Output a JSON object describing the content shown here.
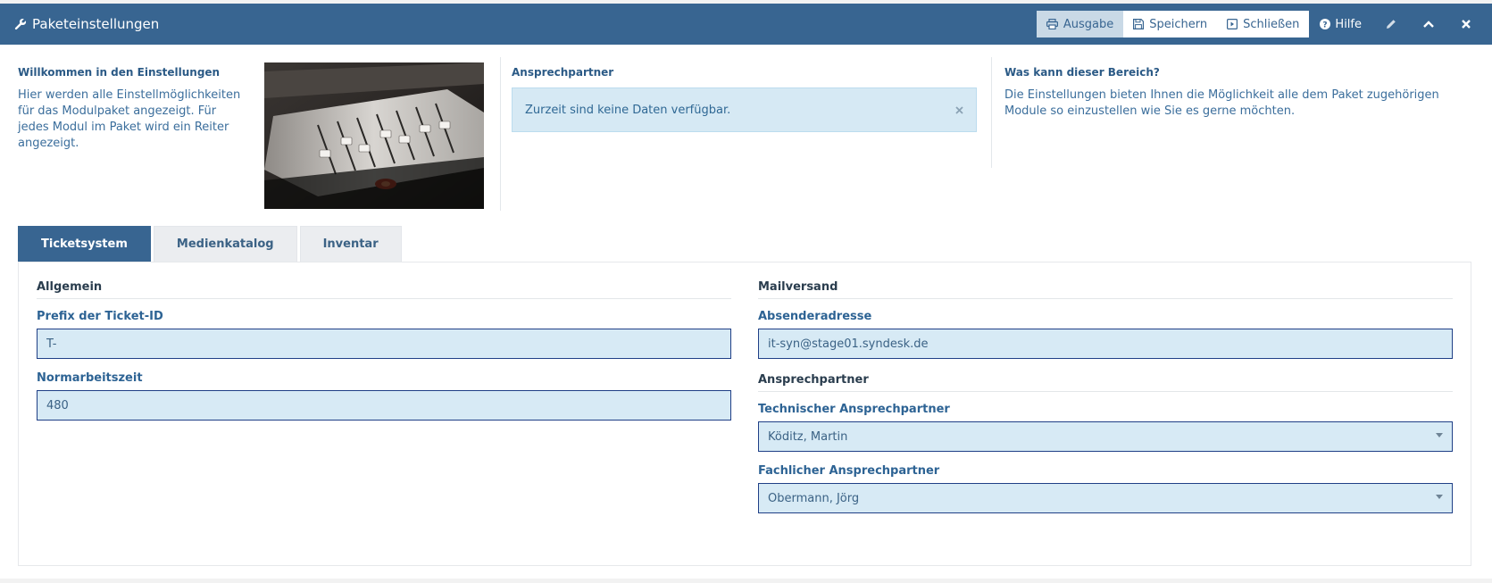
{
  "window": {
    "title": "Paketeinstellungen",
    "toolbar": {
      "output_label": "Ausgabe",
      "save_label": "Speichern",
      "close_label": "Schließen",
      "help_label": "Hilfe"
    }
  },
  "info": {
    "welcome": {
      "heading": "Willkommen in den Einstellungen",
      "text": "Hier werden alle Einstellmöglichkeiten für das Modulpaket angezeigt. Für jedes Modul im Paket wird ein Reiter angezeigt."
    },
    "contact": {
      "heading": "Ansprechpartner",
      "alert": "Zurzeit sind keine Daten verfügbar."
    },
    "about": {
      "heading": "Was kann dieser Bereich?",
      "text": "Die Einstellungen bieten Ihnen die Möglichkeit alle dem Paket zugehörigen Module so einzustellen wie Sie es gerne möchten."
    }
  },
  "tabs": [
    {
      "label": "Ticketsystem",
      "active": true
    },
    {
      "label": "Medienkatalog",
      "active": false
    },
    {
      "label": "Inventar",
      "active": false
    }
  ],
  "form": {
    "general": {
      "heading": "Allgemein",
      "prefix_label": "Prefix der Ticket-ID",
      "prefix_value": "T-",
      "worktime_label": "Normarbeitszeit",
      "worktime_value": "480"
    },
    "mail": {
      "heading": "Mailversand",
      "sender_label": "Absenderadresse",
      "sender_value": "it-syn@stage01.syndesk.de"
    },
    "contacts": {
      "heading": "Ansprechpartner",
      "technical_label": "Technischer Ansprechpartner",
      "technical_value": "Köditz, Martin",
      "functional_label": "Fachlicher Ansprechpartner",
      "functional_value": "Obermann, Jörg"
    }
  },
  "colors": {
    "header": "#386591",
    "input_bg": "#d7eaf5",
    "input_border": "#1f3f86",
    "alert_bg": "#d6e9f4"
  }
}
